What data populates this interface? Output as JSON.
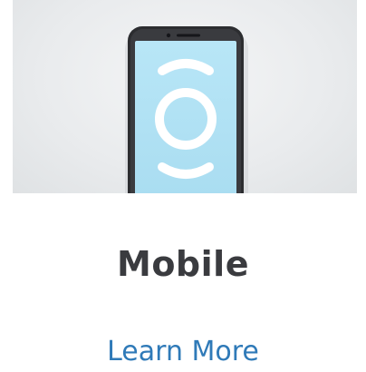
{
  "card": {
    "image_icon": "smartphone-icon",
    "screen_icon": "circle-with-arcs-icon",
    "title": "Mobile",
    "link_label": "Learn More"
  },
  "colors": {
    "title": "#3a3b3f",
    "link": "#2f7ab8",
    "screen": "#b3e3f5",
    "phone_frame": "#2c2d30",
    "hero_background": "#e9ebed"
  }
}
